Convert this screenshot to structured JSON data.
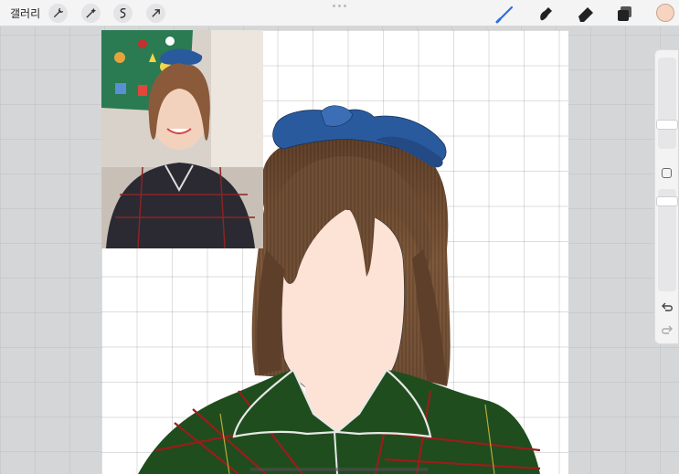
{
  "toolbar": {
    "gallery_label": "갤러리",
    "left_tools": [
      "wrench-icon",
      "magic-wand-icon",
      "selection-icon",
      "transform-arrow-icon"
    ],
    "right_tools": [
      "brush-icon",
      "smudge-icon",
      "eraser-icon",
      "layers-icon"
    ],
    "active_tool": "brush",
    "active_color": "#f6d4c0",
    "accent_color": "#2f6ee0"
  },
  "canvas": {
    "grid": true,
    "background": "#ffffff"
  },
  "sidebar": {
    "controls": [
      "brush-size-slider",
      "modify-button",
      "opacity-slider",
      "undo-button",
      "redo-button"
    ]
  },
  "colors": {
    "skin": "#fde3d6",
    "hair": "#6b4a32",
    "bow": "#2a5a9e",
    "pajama": "#1f4d1e",
    "plaid_red": "#9b1c1c"
  }
}
